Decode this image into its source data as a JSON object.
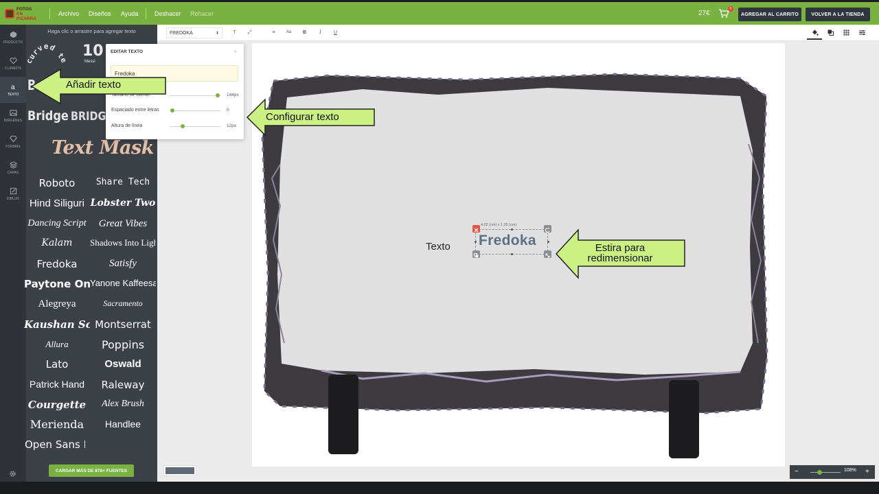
{
  "topbar": {
    "logo_line1": "FOTOS",
    "logo_line2": "EN PIZARRA",
    "menu": [
      "Archivo",
      "Diseños",
      "Ayuda"
    ],
    "undo": "Deshacer",
    "redo": "Rehacer",
    "price": "27€",
    "cart_count": "0",
    "add_to_cart": "AGREGAR AL CARRITO",
    "back_to_store": "VOLVER A LA TIENDA"
  },
  "rail": {
    "items": [
      {
        "label": "PRODUCTO",
        "icon": "cube-icon"
      },
      {
        "label": "CLIPARTS",
        "icon": "heart-icon"
      },
      {
        "label": "TEXTO",
        "icon": "text-icon"
      },
      {
        "label": "IMÁGENES",
        "icon": "image-icon"
      },
      {
        "label": "FORMAS",
        "icon": "diamond-icon"
      },
      {
        "label": "CAPAS",
        "icon": "layers-icon"
      },
      {
        "label": "DIBUJO",
        "icon": "pencil-icon"
      }
    ],
    "active_index": 2
  },
  "panel": {
    "hint": "Haga clic o arrastre para agregar texto",
    "presets": {
      "curved": "curved text",
      "ten": "10",
      "messi": "Messi",
      "bridge1": "Bridge",
      "bridge2": "Bridge",
      "bridge3": "BRIDGE",
      "mask": "Text Mask"
    },
    "fonts": [
      "Roboto",
      "Share Tech",
      "Hind Siliguri",
      "Lobster Two",
      "Dancing Script",
      "Great Vibes",
      "Kalam",
      "Shadows Into Light",
      "Fredoka",
      "Satisfy",
      "Paytone One",
      "Yanone Kaffeesatz",
      "Alegreya",
      "Sacramento",
      "Kaushan Script",
      "Montserrat",
      "Allura",
      "Poppins",
      "Lato",
      "Oswald",
      "Patrick Hand",
      "Raleway",
      "Courgette",
      "Alex Brush",
      "Merienda",
      "Handlee",
      "Open Sans D"
    ],
    "load_more": "CARGAR MÁS DE 878+ FUENTES"
  },
  "toolbar": {
    "font_name": "FREDOKA",
    "icons": [
      "font-color-icon",
      "text-effect-icon",
      "align-center-icon",
      "font-size-icon",
      "bold-icon",
      "italic-icon",
      "underline-icon"
    ],
    "right_icons": [
      "fill-icon",
      "layer-order-icon",
      "grid-icon",
      "settings-sliders-icon"
    ]
  },
  "edit_popup": {
    "title": "EDITAR TEXTO",
    "close": "×",
    "value": "Fredoka",
    "font_size_label": "Tamaño de fuente:",
    "font_size_value": "144px",
    "font_size_level": 0.95,
    "spacing_label": "Espaciado entre letras",
    "spacing_value": "0",
    "spacing_level": 0.05,
    "line_height_label": "Altura de línea",
    "line_height_value": "12px",
    "line_height_level": 0.25
  },
  "canvas": {
    "loose_text": "Texto",
    "selected_text": "Fredoka",
    "selection_size": "4.02 (cm) x 1.20 (cm)"
  },
  "callouts": {
    "add_text": "Añadir texto",
    "configure_text": "Configurar texto",
    "resize_line1": "Estira para",
    "resize_line2": "redimensionar",
    "color": "#cbf084"
  },
  "zoom": {
    "value": "108%",
    "minus": "−",
    "plus": "+",
    "level": 0.3
  },
  "colors": {
    "brand_green": "#7ab241",
    "dark_panel": "#3c4148",
    "rail": "#2f3338"
  }
}
